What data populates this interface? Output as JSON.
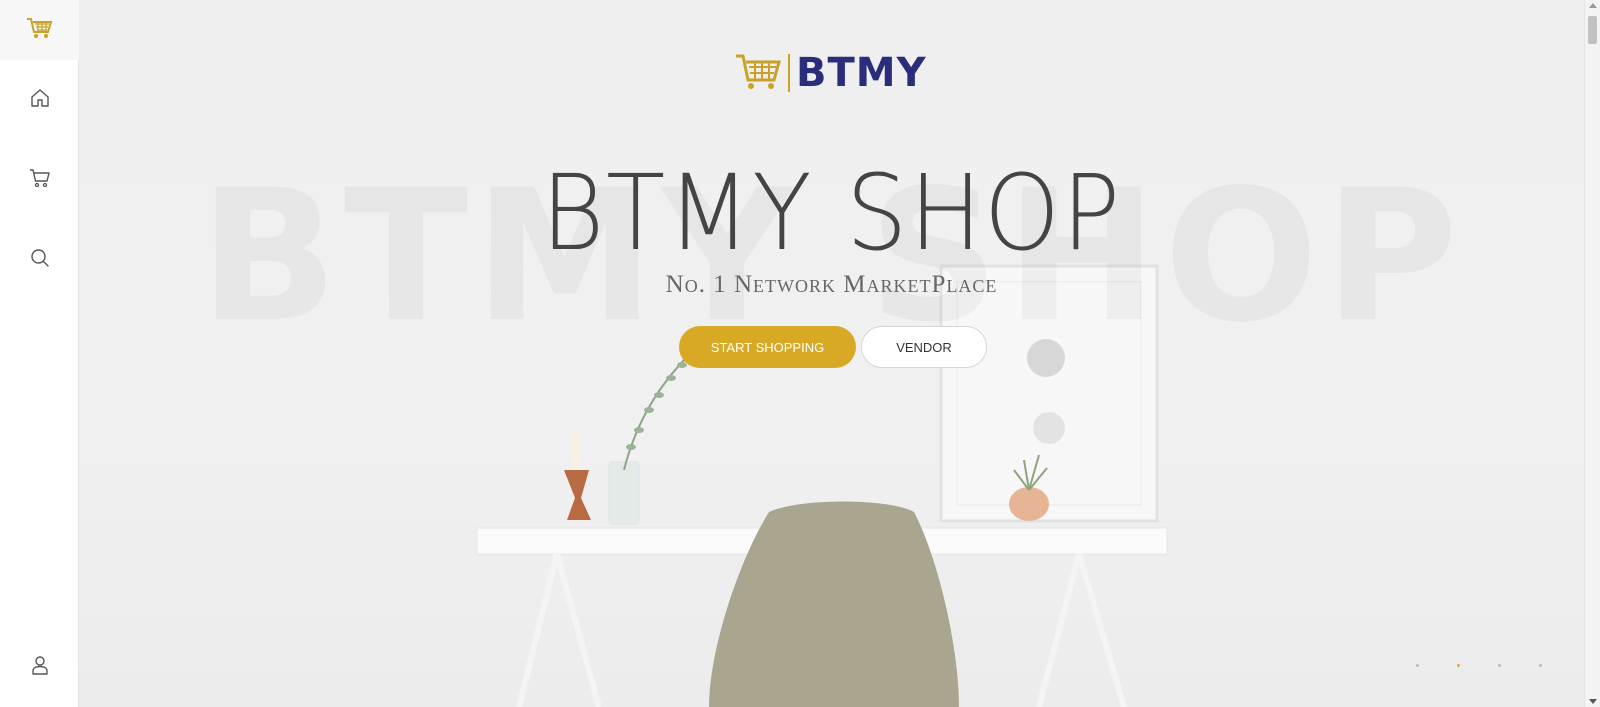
{
  "sidebar": {
    "logo_icon": "cart-logo-icon",
    "items": [
      {
        "icon": "home-icon"
      },
      {
        "icon": "cart-icon"
      },
      {
        "icon": "search-icon"
      },
      {
        "icon": "user-icon"
      }
    ]
  },
  "brand": {
    "name": "BTMY",
    "colors": {
      "navy": "#2a2d7b",
      "gold": "#c9a227"
    }
  },
  "hero": {
    "watermark": "BTMY SHOP",
    "title": "BTMY SHOP",
    "subtitle": "No. 1 Network MarketPlace",
    "buttons": {
      "start_shopping": "START SHOPPING",
      "vendor": "VENDOR"
    },
    "accent_color": "#d8a924"
  },
  "slider": {
    "slide_count": 4,
    "active_index": 1
  }
}
